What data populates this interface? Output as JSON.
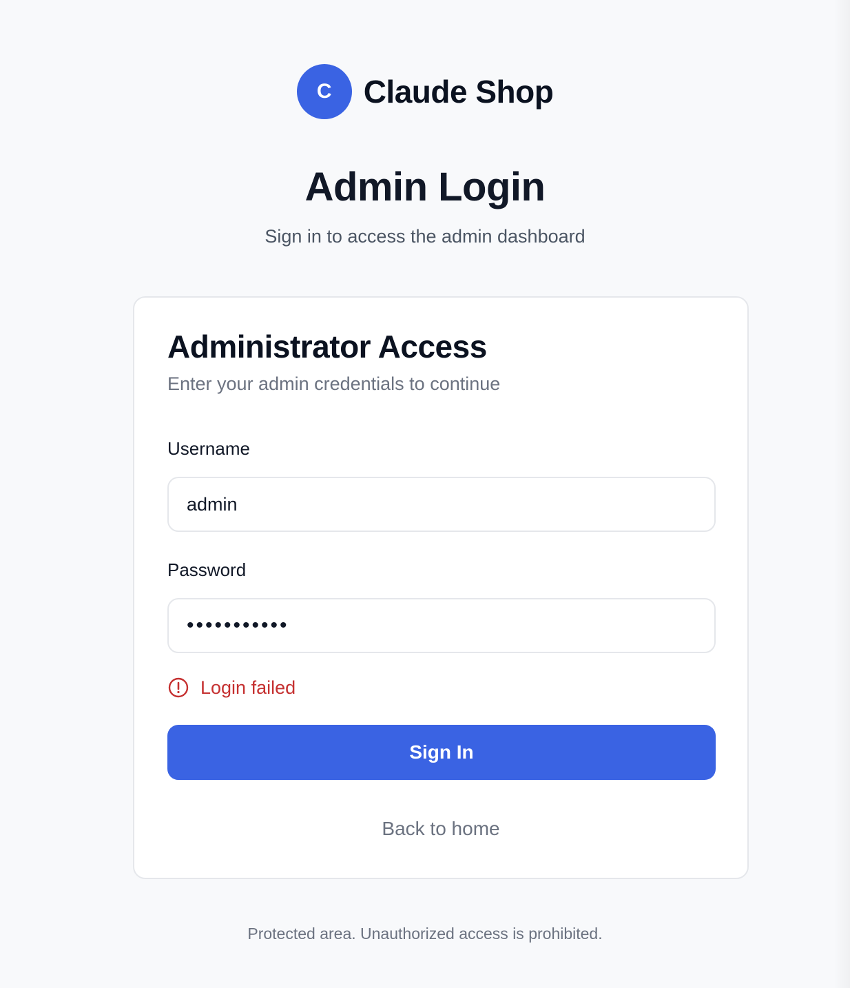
{
  "brand": {
    "logo_letter": "C",
    "name": "Claude Shop",
    "accent_color": "#3a63e3"
  },
  "header": {
    "title": "Admin Login",
    "subtitle": "Sign in to access the admin dashboard"
  },
  "card": {
    "title": "Administrator Access",
    "subtitle": "Enter your admin credentials to continue",
    "username": {
      "label": "Username",
      "value": "admin"
    },
    "password": {
      "label": "Password",
      "value": "•••••••••••"
    },
    "error": {
      "icon": "alert-circle-icon",
      "message": "Login failed",
      "color": "#c53030"
    },
    "submit_label": "Sign In",
    "back_link_label": "Back to home"
  },
  "footer": {
    "note": "Protected area. Unauthorized access is prohibited."
  }
}
